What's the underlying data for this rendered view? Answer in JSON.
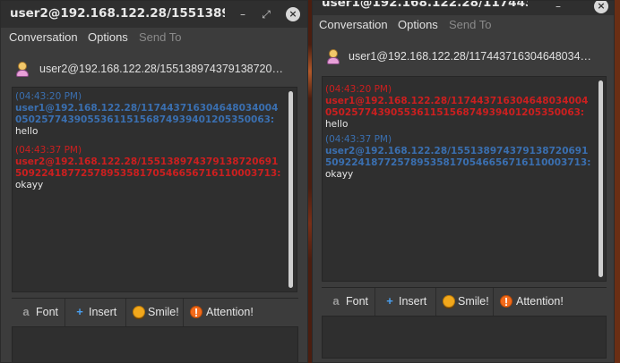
{
  "colors": {
    "local_sender": "#3a6fb0",
    "remote_sender": "#cc1f1f",
    "message_text": "#e6e6e6",
    "window_bg": "#3c3c3c",
    "chat_bg": "#2f2f2f"
  },
  "windows": [
    {
      "title": "user2@192.168.122.28/1551389…",
      "titlebar_buttons": {
        "minimize": "–",
        "maximize": "⤢",
        "close": "×"
      },
      "menu": {
        "conversation": "Conversation",
        "options": "Options",
        "send_to": "Send To"
      },
      "peer": "user2@192.168.122.28/155138974379138720…",
      "messages": [
        {
          "time": "(04:43:20 PM)",
          "sender": "user1@192.168.122.28/117443716304648034004050257743905536115156874939401205350063:",
          "text": "hello"
        },
        {
          "time": "(04:43:37 PM)",
          "sender": "user2@192.168.122.28/1551389743791387206915092241877257895358170546656716110003713:",
          "text": "okayy"
        }
      ],
      "toolbar": {
        "font": "Font",
        "insert": "Insert",
        "smile": "Smile!",
        "attention": "Attention!"
      }
    },
    {
      "title": "user1@192.168.122.28/1174437…",
      "titlebar_buttons": {
        "minimize": "–",
        "close": "×"
      },
      "menu": {
        "conversation": "Conversation",
        "options": "Options",
        "send_to": "Send To"
      },
      "peer": "user1@192.168.122.28/117443716304648034…",
      "messages": [
        {
          "time": "(04:43:20 PM)",
          "sender": "user1@192.168.122.28/117443716304648034004050257743905536115156874939401205350063:",
          "text": "hello"
        },
        {
          "time": "(04:43:37 PM)",
          "sender": "user2@192.168.122.28/1551389743791387206915092241877257895358170546656716110003713:",
          "text": "okayy"
        }
      ],
      "toolbar": {
        "font": "Font",
        "insert": "Insert",
        "smile": "Smile!",
        "attention": "Attention!"
      }
    }
  ]
}
